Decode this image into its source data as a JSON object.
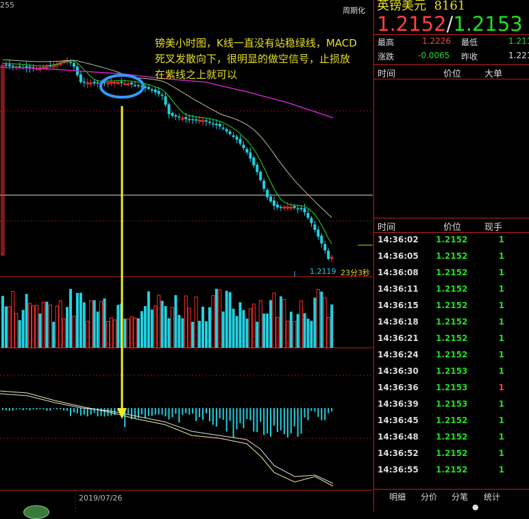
{
  "chart_header": {
    "top_left_label": "255",
    "period_button": "周期化"
  },
  "annotation": {
    "text_lines": [
      "镑美小时图，K线一直没有站稳绿线，MACD",
      "死叉发散向下，很明显的做空信号，止损放",
      "在紫线之上就可以"
    ]
  },
  "price_label": "1.2119",
  "countdown_label": "23分3秒",
  "date_label": "2019/07/26",
  "quote": {
    "title": "英镑美元",
    "code": "8161",
    "bid": "1.2152",
    "separator": "/",
    "ask": "1.2153",
    "high_label": "最高",
    "high_value": "1.2226",
    "low_label": "最低",
    "low_value": "1.211",
    "change_label": "涨跌",
    "change_value": "-0.0065",
    "prev_close_label": "昨收",
    "prev_close_value": "1.221"
  },
  "big_orders": {
    "headers": [
      "时间",
      "价位",
      "大单"
    ]
  },
  "ticks": {
    "headers": [
      "时间",
      "价位",
      "现手"
    ],
    "rows": [
      {
        "time": "14:36:02",
        "price": "1.2152",
        "vol": "1",
        "dir": "g"
      },
      {
        "time": "14:36:05",
        "price": "1.2152",
        "vol": "1",
        "dir": "g"
      },
      {
        "time": "14:36:08",
        "price": "1.2152",
        "vol": "1",
        "dir": "g"
      },
      {
        "time": "14:36:11",
        "price": "1.2152",
        "vol": "1",
        "dir": "g"
      },
      {
        "time": "14:36:15",
        "price": "1.2152",
        "vol": "1",
        "dir": "g"
      },
      {
        "time": "14:36:18",
        "price": "1.2152",
        "vol": "1",
        "dir": "g"
      },
      {
        "time": "14:36:21",
        "price": "1.2152",
        "vol": "1",
        "dir": "g"
      },
      {
        "time": "14:36:24",
        "price": "1.2152",
        "vol": "1",
        "dir": "g"
      },
      {
        "time": "14:36:30",
        "price": "1.2153",
        "vol": "1",
        "dir": "g"
      },
      {
        "time": "14:36:36",
        "price": "1.2153",
        "vol": "1",
        "dir": "r"
      },
      {
        "time": "14:36:39",
        "price": "1.2153",
        "vol": "1",
        "dir": "g"
      },
      {
        "time": "14:36:45",
        "price": "1.2152",
        "vol": "1",
        "dir": "g"
      },
      {
        "time": "14:36:48",
        "price": "1.2152",
        "vol": "1",
        "dir": "g"
      },
      {
        "time": "14:36:52",
        "price": "1.2152",
        "vol": "1",
        "dir": "g"
      },
      {
        "time": "14:36:55",
        "price": "1.2152",
        "vol": "1",
        "dir": "g"
      }
    ]
  },
  "tabs": [
    "明细",
    "分价",
    "分笔",
    "统计"
  ],
  "colors": {
    "up": "#ff3030",
    "down": "#22d0e0",
    "ma_fast": "#22dd22",
    "ma_slow": "#c0c0a0",
    "ma_purple": "#cc22cc",
    "annotation": "#e8e020",
    "circle": "#3399ff",
    "arrow": "#f0f020"
  }
}
